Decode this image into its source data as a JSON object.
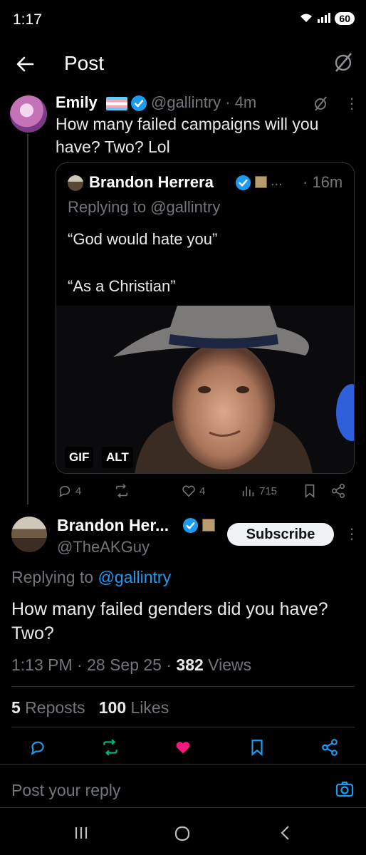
{
  "status_bar": {
    "time": "1:17",
    "battery": "60"
  },
  "header": {
    "title": "Post"
  },
  "parent_tweet": {
    "name": "Emily",
    "handle_time": "@gallintry · 4m",
    "text": "How many failed campaigns will you have? Two? Lol",
    "quote": {
      "name": "Brandon Herrera",
      "ellipsis": "...",
      "time": "· 16m",
      "replying_to": "Replying to @gallintry",
      "line1": "“God would hate you”",
      "line2": "“As a Christian”",
      "media_tags": [
        "GIF",
        "ALT"
      ]
    },
    "actions": {
      "replies": "4",
      "reposts": "",
      "likes": "4",
      "views": "715"
    }
  },
  "main_tweet": {
    "name": "Brandon Her...",
    "handle": "@TheAKGuy",
    "subscribe_label": "Subscribe",
    "replying_prefix": "Replying to ",
    "replying_handle": "@gallintry",
    "text": "How many failed genders did you have? Two?",
    "time": "1:13 PM · 28 Sep 25 · ",
    "views_count": "382",
    "views_label": " Views",
    "reposts_count": "5",
    "reposts_label": " Reposts",
    "likes_count": "100",
    "likes_label": " Likes"
  },
  "reply_bar": {
    "placeholder": "Post your reply"
  },
  "colors": {
    "accent": "#1d9bf0",
    "like": "#f91880",
    "repost": "#00ba7c",
    "muted": "#71767b"
  }
}
